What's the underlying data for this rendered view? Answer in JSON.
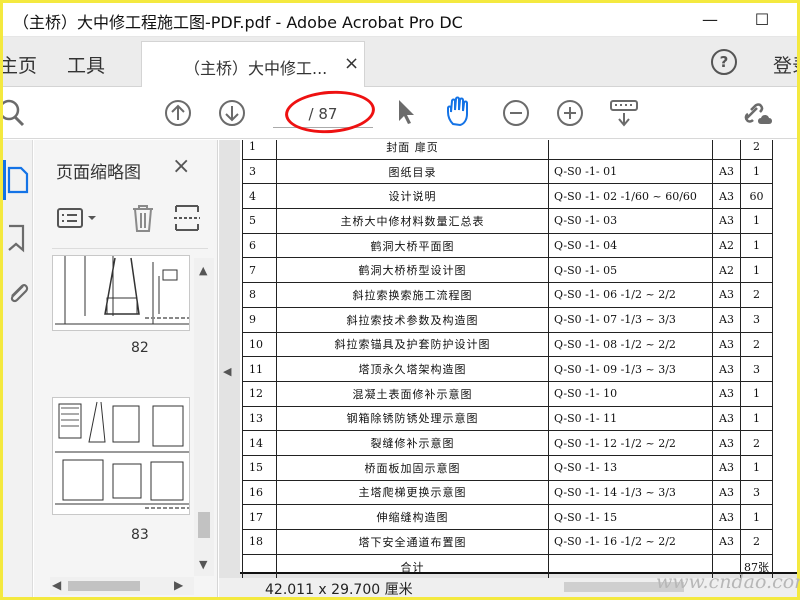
{
  "window": {
    "title": "（主桥）大中修工程施工图-PDF.pdf - Adobe Acrobat Pro DC",
    "minimize_symbol": "—",
    "maximize_symbol": "☐"
  },
  "nav": {
    "home": "主页",
    "tools": "工具",
    "doc_tab_label": "（主桥）大中修工...",
    "doc_tab_close": "×",
    "help_symbol": "?",
    "sign_in": "登录"
  },
  "toolbar": {
    "page_display": "/ 87",
    "icons": [
      "search-icon",
      "prev-page-icon",
      "next-page-icon",
      "select-cursor-icon",
      "hand-tool-icon",
      "zoom-out-icon",
      "zoom-in-icon",
      "scroll-mode-icon",
      "share-link-icon"
    ],
    "annotation_color": "#e01010"
  },
  "sidebar": {
    "icons": [
      "page-thumbnails-icon",
      "bookmarks-icon",
      "attachments-icon"
    ],
    "active_color": "#1473e6"
  },
  "thumbnail_panel": {
    "title": "页面缩略图",
    "close": "×",
    "tools": [
      "thumbnail-options-icon",
      "delete-page-icon",
      "extract-pages-icon"
    ],
    "pages": [
      "82",
      "83"
    ]
  },
  "document": {
    "rows": [
      [
        "1",
        "封面 扉页",
        "",
        "",
        "2"
      ],
      [
        "3",
        "图纸目录",
        "Q-S0 -1- 01",
        "A3",
        "1"
      ],
      [
        "4",
        "设计说明",
        "Q-S0 -1- 02 -1/60 ~ 60/60",
        "A3",
        "60"
      ],
      [
        "5",
        "主桥大中修材料数量汇总表",
        "Q-S0 -1- 03",
        "A3",
        "1"
      ],
      [
        "6",
        "鹤洞大桥平面图",
        "Q-S0 -1- 04",
        "A2",
        "1"
      ],
      [
        "7",
        "鹤洞大桥桥型设计图",
        "Q-S0 -1- 05",
        "A2",
        "1"
      ],
      [
        "8",
        "斜拉索换索施工流程图",
        "Q-S0 -1- 06 -1/2 ~ 2/2",
        "A3",
        "2"
      ],
      [
        "9",
        "斜拉索技术参数及构造图",
        "Q-S0 -1- 07 -1/3 ~ 3/3",
        "A3",
        "3"
      ],
      [
        "10",
        "斜拉索锚具及护套防护设计图",
        "Q-S0 -1- 08 -1/2 ~ 2/2",
        "A3",
        "2"
      ],
      [
        "11",
        "塔顶永久塔架构造图",
        "Q-S0 -1- 09 -1/3 ~ 3/3",
        "A3",
        "3"
      ],
      [
        "12",
        "混凝土表面修补示意图",
        "Q-S0 -1- 10",
        "A3",
        "1"
      ],
      [
        "13",
        "钢箱除锈防锈处理示意图",
        "Q-S0 -1- 11",
        "A3",
        "1"
      ],
      [
        "14",
        "裂缝修补示意图",
        "Q-S0 -1- 12 -1/2 ~ 2/2",
        "A3",
        "2"
      ],
      [
        "15",
        "桥面板加固示意图",
        "Q-S0 -1- 13",
        "A3",
        "1"
      ],
      [
        "16",
        "主塔爬梯更换示意图",
        "Q-S0 -1- 14 -1/3 ~ 3/3",
        "A3",
        "3"
      ],
      [
        "17",
        "伸缩缝构造图",
        "Q-S0 -1- 15",
        "A3",
        "1"
      ],
      [
        "18",
        "塔下安全通道布置图",
        "Q-S0 -1- 16 -1/2 ~ 2/2",
        "A3",
        "2"
      ]
    ],
    "total_label": "合计",
    "total_value": "87张"
  },
  "status": {
    "page_size": "42.011 x 29.700 厘米"
  },
  "watermark": "www.cndao.com",
  "colors": {
    "frame": "#f4e93f",
    "toolbar_icon": "#6b6b6b",
    "hand_tool": "#1473e6"
  }
}
